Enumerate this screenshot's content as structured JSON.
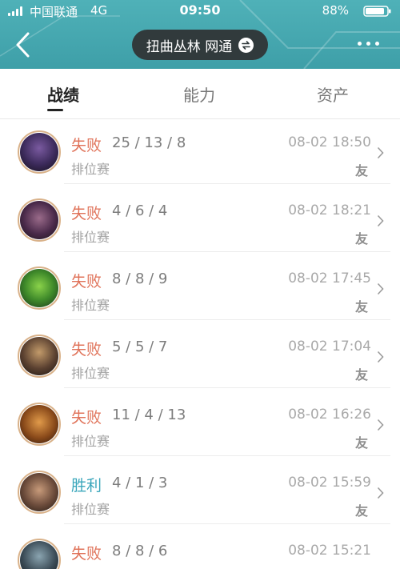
{
  "status_bar": {
    "carrier": "中国联通",
    "network": "4G",
    "time": "09:50",
    "battery": "88%"
  },
  "header": {
    "title": "扭曲丛林 网通"
  },
  "tabs": [
    {
      "label": "战绩",
      "active": true
    },
    {
      "label": "能力",
      "active": false
    },
    {
      "label": "资产",
      "active": false
    }
  ],
  "matches": [
    {
      "result": "失败",
      "outcome": "lose",
      "kda": "25 / 13 / 8",
      "mode": "排位赛",
      "time": "08-02 18:50",
      "tag": "友",
      "avatar": "champion-avatar"
    },
    {
      "result": "失败",
      "outcome": "lose",
      "kda": "4 / 6 / 4",
      "mode": "排位赛",
      "time": "08-02 18:21",
      "tag": "友",
      "avatar": "champion-avatar"
    },
    {
      "result": "失败",
      "outcome": "lose",
      "kda": "8 / 8 / 9",
      "mode": "排位赛",
      "time": "08-02 17:45",
      "tag": "友",
      "avatar": "champion-avatar"
    },
    {
      "result": "失败",
      "outcome": "lose",
      "kda": "5 / 5 / 7",
      "mode": "排位赛",
      "time": "08-02 17:04",
      "tag": "友",
      "avatar": "champion-avatar"
    },
    {
      "result": "失败",
      "outcome": "lose",
      "kda": "11 / 4 / 13",
      "mode": "排位赛",
      "time": "08-02 16:26",
      "tag": "友",
      "avatar": "champion-avatar"
    },
    {
      "result": "胜利",
      "outcome": "win",
      "kda": "4 / 1 / 3",
      "mode": "排位赛",
      "time": "08-02 15:59",
      "tag": "友",
      "avatar": "champion-avatar"
    },
    {
      "result": "失败",
      "outcome": "lose",
      "kda": "8 / 8 / 6",
      "mode": "",
      "time": "08-02 15:21",
      "tag": "",
      "avatar": "champion-avatar"
    }
  ],
  "colors": {
    "header": "#4fb1b8",
    "lose": "#e0735a",
    "win": "#3aa6bb"
  }
}
